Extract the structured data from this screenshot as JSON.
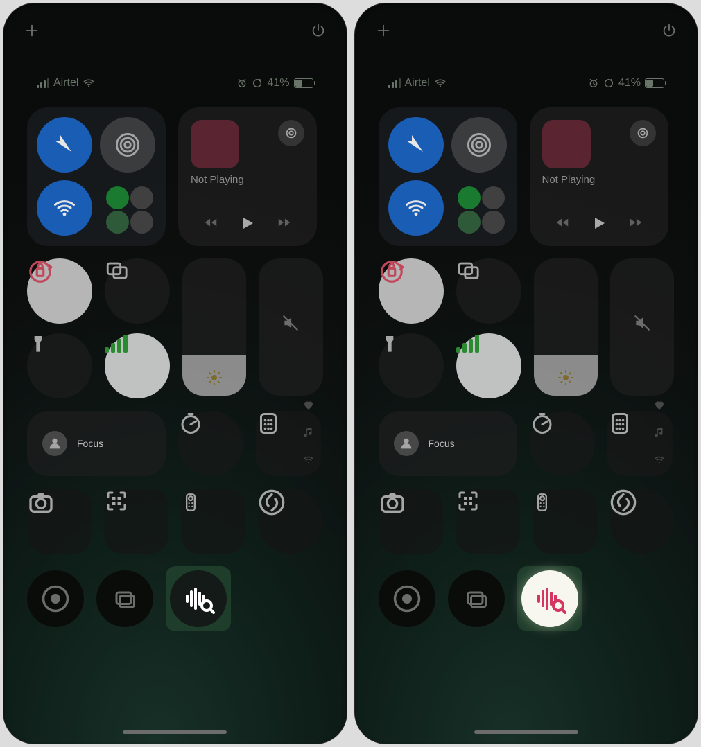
{
  "status_left": {
    "carrier": "Airtel"
  },
  "status_right": {
    "battery_pct": "41%"
  },
  "media": {
    "label": "Not Playing"
  },
  "focus": {
    "label": "Focus"
  },
  "icons": {
    "add": "add-icon",
    "power": "power-icon",
    "airplane": "airplane-icon",
    "airdrop": "airdrop-icon",
    "wifi": "wifi-icon",
    "airplay": "airplay-icon",
    "play": "play-icon",
    "prev": "rewind-icon",
    "next": "forward-icon",
    "lock": "orientation-lock-icon",
    "screenmirror": "screen-mirror-icon",
    "flashlight": "flashlight-icon",
    "cellular": "cellular-icon",
    "brightness": "brightness-slider",
    "volume": "volume-slider",
    "heart": "favorites-dot",
    "music": "music-dot",
    "antenna": "connectivity-dot",
    "focus_person": "person-icon",
    "timer": "timer-icon",
    "calculator": "calculator-icon",
    "camera": "camera-icon",
    "qr": "qr-scanner-icon",
    "tv_remote": "tv-remote-icon",
    "shazam": "shazam-icon",
    "record": "screen-record-icon",
    "windows": "stage-manager-icon",
    "music_recog": "music-recognition-icon"
  },
  "highlight": {
    "left_state": "off",
    "right_state": "on",
    "accent_off": "#ffffff",
    "accent_on": "#d43660"
  }
}
